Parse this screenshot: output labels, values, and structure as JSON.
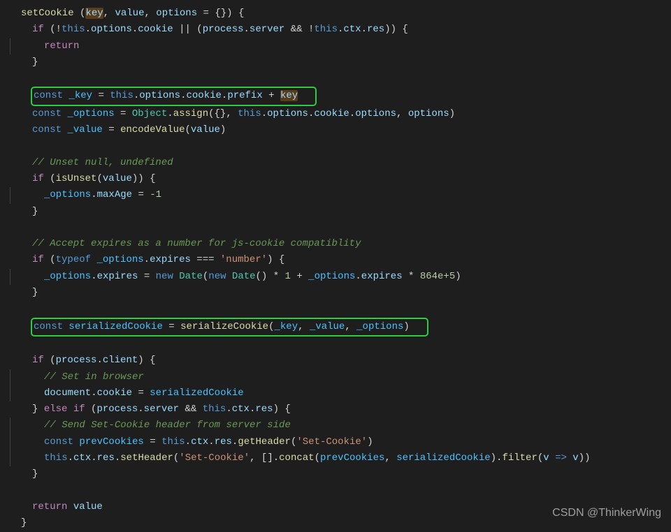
{
  "watermark": "CSDN @ThinkerWing",
  "code": {
    "l1_fn": "setCookie",
    "l1_p1": "key",
    "l1_p2": "value",
    "l1_p3": "options",
    "l1_default": "{}",
    "l2_if": "if",
    "l2_this": "this",
    "l2_opts": "options",
    "l2_cookie": "cookie",
    "l2_process": "process",
    "l2_server": "server",
    "l2_ctx": "ctx",
    "l2_res": "res",
    "l3_return": "return",
    "l6_const": "const",
    "l6_key": "_key",
    "l6_prefix": "prefix",
    "l7_opts": "_options",
    "l7_obj": "Object",
    "l7_assign": "assign",
    "l8_value": "_value",
    "l8_enc": "encodeValue",
    "c1": "// Unset null, undefined",
    "l11_isUnset": "isUnset",
    "l12_maxAge": "maxAge",
    "l12_neg1": "-1",
    "c2": "// Accept expires as a number for js-cookie compatiblity",
    "l15_typeof": "typeof",
    "l15_expires": "expires",
    "l15_numstr": "'number'",
    "l16_new": "new",
    "l16_Date": "Date",
    "l16_1": "1",
    "l16_864": "864e+5",
    "l18_sc": "serializedCookie",
    "l18_scfn": "serializeCookie",
    "l20_client": "client",
    "c3": "// Set in browser",
    "l22_document": "document",
    "c4": "// Send Set-Cookie header from server side",
    "l25_prev": "prevCookies",
    "l25_getHeader": "getHeader",
    "l25_setcookie": "'Set-Cookie'",
    "l26_setHeader": "setHeader",
    "l26_concat": "concat",
    "l26_filter": "filter",
    "l26_v": "v"
  }
}
